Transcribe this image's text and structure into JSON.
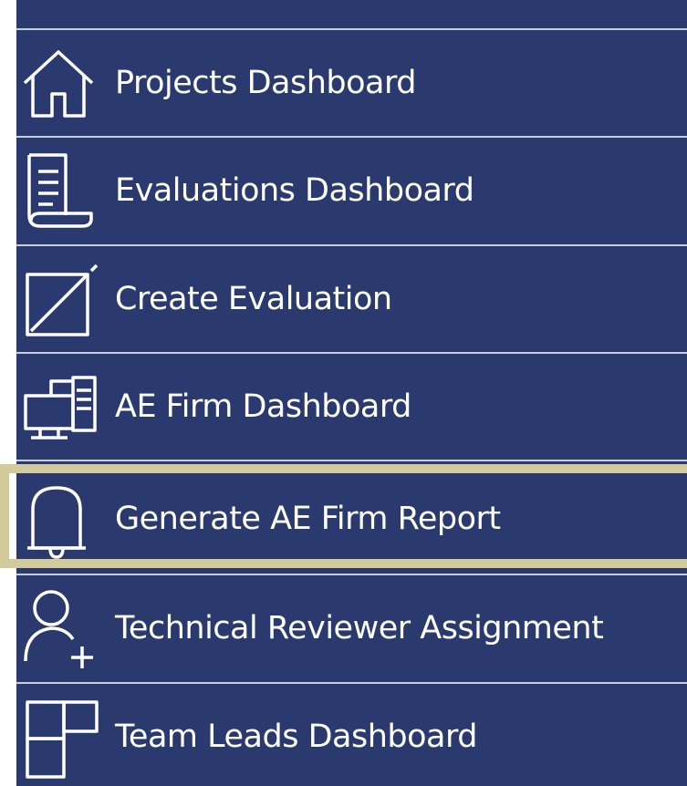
{
  "colors": {
    "panel_bg": "#2a3a6e",
    "divider": "#c9cedb",
    "text": "#ffffff",
    "active_highlight": "#d3ca9c"
  },
  "nav": {
    "active_item": "Generate AE Firm Report",
    "items": [
      {
        "label": "Projects Dashboard",
        "icon": "home-icon"
      },
      {
        "label": "Evaluations Dashboard",
        "icon": "document-scroll-icon"
      },
      {
        "label": "Create Evaluation",
        "icon": "edit-box-icon"
      },
      {
        "label": "AE Firm Dashboard",
        "icon": "computer-monitor-icon"
      },
      {
        "label": "Generate AE Firm Report",
        "icon": "bell-icon"
      },
      {
        "label": "Technical Reviewer Assignment",
        "icon": "add-user-icon"
      },
      {
        "label": "Team Leads Dashboard",
        "icon": "tiles-grid-icon"
      }
    ]
  }
}
